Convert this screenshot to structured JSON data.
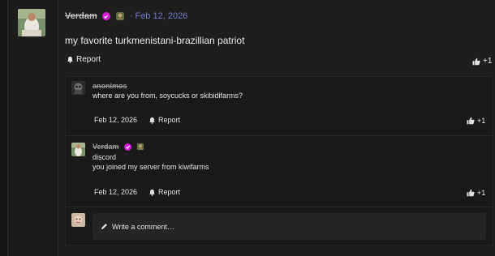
{
  "post": {
    "username": "Verdam",
    "date": "· Feb 12, 2026",
    "text": "my favorite turkmenistani-brazillian patriot",
    "report_label": "Report",
    "like_count": "+1"
  },
  "replies": [
    {
      "username": "anonimos",
      "text_lines": [
        "where are you from, soycucks or skibidifarms?"
      ],
      "date": "Feb 12, 2026",
      "report_label": "Report",
      "like_count": "+1"
    },
    {
      "username": "Verdam",
      "text_lines": [
        "discord",
        "you joined my server from kiwifarms"
      ],
      "date": "Feb 12, 2026",
      "report_label": "Report",
      "like_count": "+1"
    }
  ],
  "comment_box": {
    "placeholder": "Write a comment…"
  },
  "colors": {
    "verified_badge": "#d21fd3",
    "date_accent": "#6c78c9"
  },
  "icons": [
    "verified-badge-icon",
    "rank-badge-icon",
    "bell-icon",
    "thumbs-up-icon",
    "pencil-icon"
  ]
}
